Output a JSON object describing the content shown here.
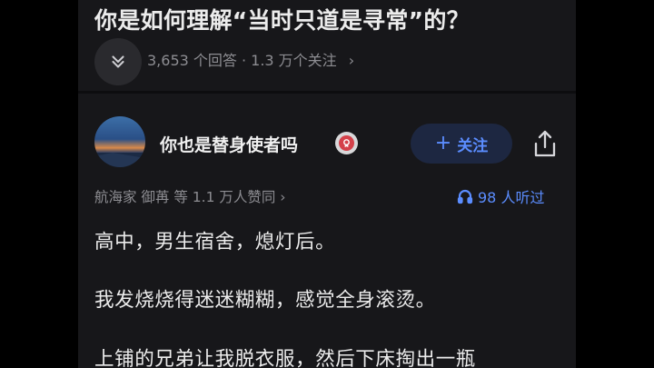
{
  "question": {
    "title": "你是如何理解“当时只道是寻常”的？",
    "meta": "3,653 个回答 · 1.3 万个关注",
    "meta_chevron": "›"
  },
  "answer": {
    "author_name": "你也是替身使者吗",
    "follow_label": "关注",
    "follow_icon": "+",
    "upvoters": "航海家 御苒 等 1.1 万人赞同 ›",
    "listen_count": "98 人听过",
    "paragraphs": [
      "高中，男生宿舍，熄灯后。",
      "我发烧烧得迷迷糊糊，感觉全身滚烫。",
      "上铺的兄弟让我脱衣服，然后下床掏出一瓶"
    ]
  },
  "colors": {
    "background": "#17171a",
    "accent": "#5b8dff",
    "follow_bg": "#1d2741",
    "text_primary": "#ececec",
    "text_secondary": "#8d8d92"
  },
  "icons": [
    "chevrons-down-icon",
    "share-icon",
    "headphones-icon",
    "badge-icon"
  ]
}
